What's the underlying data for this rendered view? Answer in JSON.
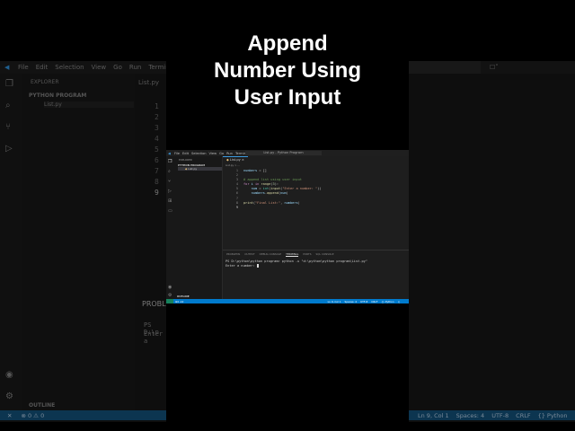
{
  "overlay_title": [
    "Append",
    "Number Using",
    "User Input"
  ],
  "menu": [
    "File",
    "Edit",
    "Selection",
    "View",
    "Go",
    "Run",
    "Terminal",
    "Help"
  ],
  "window_title": "List.py - Python Program",
  "explorer": {
    "header": "EXPLORER",
    "folder": "PYTHON PROGRAM",
    "file": "List.py",
    "outline": "OUTLINE"
  },
  "editor": {
    "tab": "List.py",
    "breadcrumb": "List.py > ...",
    "line_numbers": [
      "1",
      "2",
      "3",
      "4",
      "5",
      "6",
      "7",
      "8",
      "9"
    ]
  },
  "panel": {
    "tabs": [
      "PROBLEMS",
      "OUTPUT",
      "DEBUG CONSOLE",
      "TERMINAL",
      "PORTS",
      "SQL CONSOLE"
    ],
    "terminal_lines": [
      "PS D:\\python\\python program> python -u \"d:\\python\\python program\\List.py\"",
      "Enter a number: "
    ],
    "bg_problems": "PROBLEMS",
    "bg_term1": "PS D:\\p",
    "bg_term2": "Enter a"
  },
  "status": {
    "position": "Ln 9, Col 1",
    "spaces": "Spaces: 4",
    "encoding": "UTF-8",
    "eol": "CRLF",
    "language": "{} Python",
    "errors": "0",
    "warnings": "0"
  },
  "colors": {
    "status_bar": "#007acc",
    "editor_bg": "#1e1e1e"
  }
}
